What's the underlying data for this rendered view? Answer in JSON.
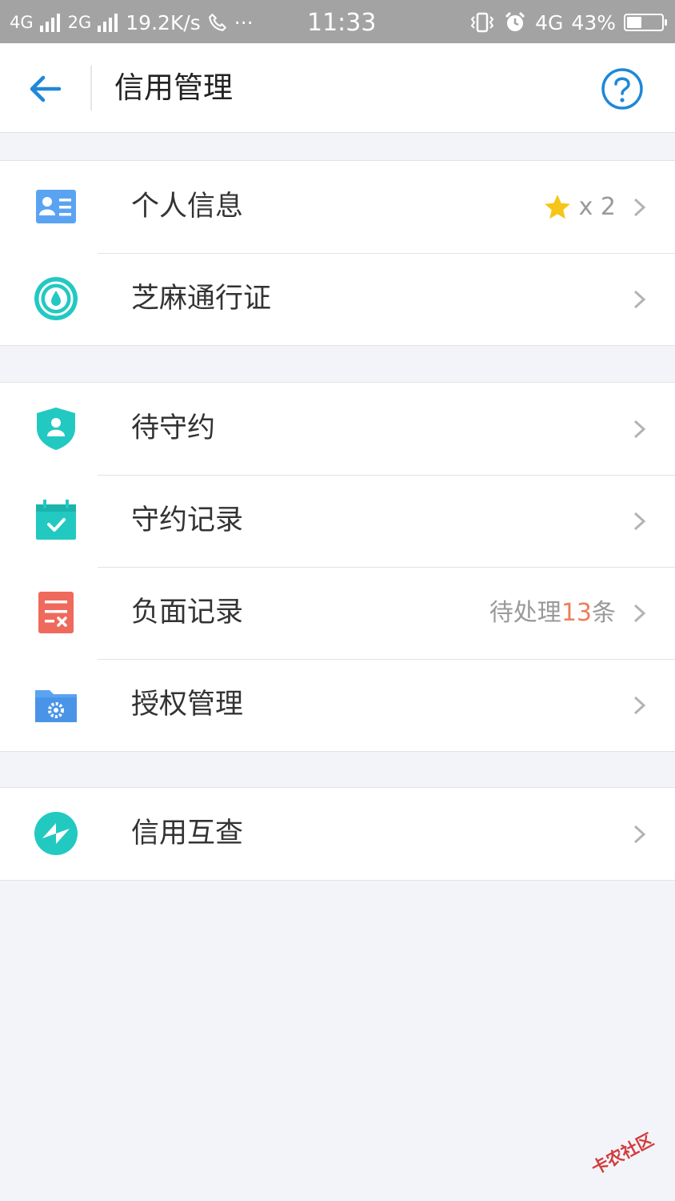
{
  "status_bar": {
    "network1": "4G",
    "network2": "2G",
    "speed": "19.2K/s",
    "dots": "···",
    "time": "11:33",
    "network3": "4G",
    "battery": "43%",
    "battery_level": 0.43
  },
  "header": {
    "title": "信用管理",
    "back_icon": "arrow-left-icon",
    "help_icon": "question-circle-icon",
    "accent_color": "#1e88d8"
  },
  "groups": [
    {
      "items": [
        {
          "label": "个人信息",
          "extra_x": "x",
          "extra_count": "2",
          "icon": "id-card-icon"
        },
        {
          "label": "芝麻通行证",
          "icon": "sesame-pass-icon"
        }
      ]
    },
    {
      "items": [
        {
          "label": "待守约",
          "icon": "shield-user-icon"
        },
        {
          "label": "守约记录",
          "icon": "calendar-check-icon"
        },
        {
          "label": "负面记录",
          "extra_prefix": "待处理",
          "extra_number": "13",
          "extra_suffix": "条",
          "icon": "document-x-icon"
        },
        {
          "label": "授权管理",
          "icon": "folder-gear-icon"
        }
      ]
    },
    {
      "items": [
        {
          "label": "信用互查",
          "icon": "mutual-check-icon"
        }
      ]
    }
  ],
  "watermark": "卡农社区"
}
